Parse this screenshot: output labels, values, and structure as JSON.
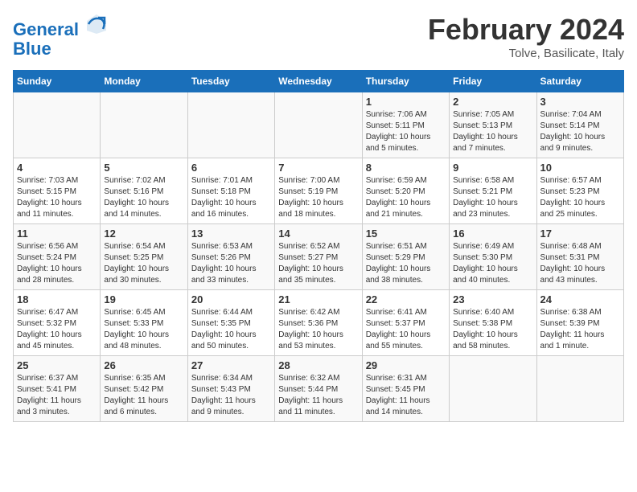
{
  "header": {
    "logo_line1": "General",
    "logo_line2": "Blue",
    "month_title": "February 2024",
    "location": "Tolve, Basilicate, Italy"
  },
  "days_of_week": [
    "Sunday",
    "Monday",
    "Tuesday",
    "Wednesday",
    "Thursday",
    "Friday",
    "Saturday"
  ],
  "weeks": [
    [
      {
        "day": "",
        "info": ""
      },
      {
        "day": "",
        "info": ""
      },
      {
        "day": "",
        "info": ""
      },
      {
        "day": "",
        "info": ""
      },
      {
        "day": "1",
        "info": "Sunrise: 7:06 AM\nSunset: 5:11 PM\nDaylight: 10 hours\nand 5 minutes."
      },
      {
        "day": "2",
        "info": "Sunrise: 7:05 AM\nSunset: 5:13 PM\nDaylight: 10 hours\nand 7 minutes."
      },
      {
        "day": "3",
        "info": "Sunrise: 7:04 AM\nSunset: 5:14 PM\nDaylight: 10 hours\nand 9 minutes."
      }
    ],
    [
      {
        "day": "4",
        "info": "Sunrise: 7:03 AM\nSunset: 5:15 PM\nDaylight: 10 hours\nand 11 minutes."
      },
      {
        "day": "5",
        "info": "Sunrise: 7:02 AM\nSunset: 5:16 PM\nDaylight: 10 hours\nand 14 minutes."
      },
      {
        "day": "6",
        "info": "Sunrise: 7:01 AM\nSunset: 5:18 PM\nDaylight: 10 hours\nand 16 minutes."
      },
      {
        "day": "7",
        "info": "Sunrise: 7:00 AM\nSunset: 5:19 PM\nDaylight: 10 hours\nand 18 minutes."
      },
      {
        "day": "8",
        "info": "Sunrise: 6:59 AM\nSunset: 5:20 PM\nDaylight: 10 hours\nand 21 minutes."
      },
      {
        "day": "9",
        "info": "Sunrise: 6:58 AM\nSunset: 5:21 PM\nDaylight: 10 hours\nand 23 minutes."
      },
      {
        "day": "10",
        "info": "Sunrise: 6:57 AM\nSunset: 5:23 PM\nDaylight: 10 hours\nand 25 minutes."
      }
    ],
    [
      {
        "day": "11",
        "info": "Sunrise: 6:56 AM\nSunset: 5:24 PM\nDaylight: 10 hours\nand 28 minutes."
      },
      {
        "day": "12",
        "info": "Sunrise: 6:54 AM\nSunset: 5:25 PM\nDaylight: 10 hours\nand 30 minutes."
      },
      {
        "day": "13",
        "info": "Sunrise: 6:53 AM\nSunset: 5:26 PM\nDaylight: 10 hours\nand 33 minutes."
      },
      {
        "day": "14",
        "info": "Sunrise: 6:52 AM\nSunset: 5:27 PM\nDaylight: 10 hours\nand 35 minutes."
      },
      {
        "day": "15",
        "info": "Sunrise: 6:51 AM\nSunset: 5:29 PM\nDaylight: 10 hours\nand 38 minutes."
      },
      {
        "day": "16",
        "info": "Sunrise: 6:49 AM\nSunset: 5:30 PM\nDaylight: 10 hours\nand 40 minutes."
      },
      {
        "day": "17",
        "info": "Sunrise: 6:48 AM\nSunset: 5:31 PM\nDaylight: 10 hours\nand 43 minutes."
      }
    ],
    [
      {
        "day": "18",
        "info": "Sunrise: 6:47 AM\nSunset: 5:32 PM\nDaylight: 10 hours\nand 45 minutes."
      },
      {
        "day": "19",
        "info": "Sunrise: 6:45 AM\nSunset: 5:33 PM\nDaylight: 10 hours\nand 48 minutes."
      },
      {
        "day": "20",
        "info": "Sunrise: 6:44 AM\nSunset: 5:35 PM\nDaylight: 10 hours\nand 50 minutes."
      },
      {
        "day": "21",
        "info": "Sunrise: 6:42 AM\nSunset: 5:36 PM\nDaylight: 10 hours\nand 53 minutes."
      },
      {
        "day": "22",
        "info": "Sunrise: 6:41 AM\nSunset: 5:37 PM\nDaylight: 10 hours\nand 55 minutes."
      },
      {
        "day": "23",
        "info": "Sunrise: 6:40 AM\nSunset: 5:38 PM\nDaylight: 10 hours\nand 58 minutes."
      },
      {
        "day": "24",
        "info": "Sunrise: 6:38 AM\nSunset: 5:39 PM\nDaylight: 11 hours\nand 1 minute."
      }
    ],
    [
      {
        "day": "25",
        "info": "Sunrise: 6:37 AM\nSunset: 5:41 PM\nDaylight: 11 hours\nand 3 minutes."
      },
      {
        "day": "26",
        "info": "Sunrise: 6:35 AM\nSunset: 5:42 PM\nDaylight: 11 hours\nand 6 minutes."
      },
      {
        "day": "27",
        "info": "Sunrise: 6:34 AM\nSunset: 5:43 PM\nDaylight: 11 hours\nand 9 minutes."
      },
      {
        "day": "28",
        "info": "Sunrise: 6:32 AM\nSunset: 5:44 PM\nDaylight: 11 hours\nand 11 minutes."
      },
      {
        "day": "29",
        "info": "Sunrise: 6:31 AM\nSunset: 5:45 PM\nDaylight: 11 hours\nand 14 minutes."
      },
      {
        "day": "",
        "info": ""
      },
      {
        "day": "",
        "info": ""
      }
    ]
  ]
}
